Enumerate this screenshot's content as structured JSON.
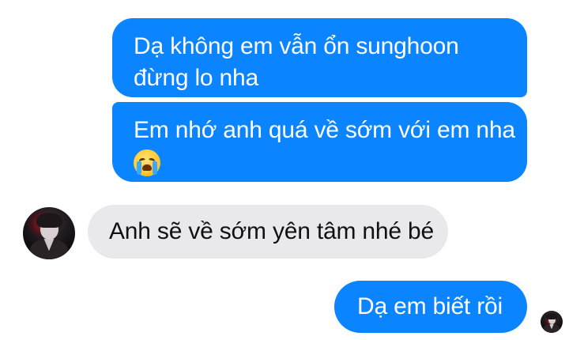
{
  "conversation": {
    "messages": [
      {
        "direction": "sent",
        "lines": [
          "Dạ không em vẫn ổn sunghoon",
          "đừng lo nha"
        ]
      },
      {
        "direction": "sent",
        "lines": [
          "Em nhớ anh quá về sớm với em nha"
        ],
        "emoji": "loudly-crying-face-icon"
      },
      {
        "direction": "received",
        "lines": [
          "Anh sẽ về sớm yên tâm nhé bé"
        ],
        "avatar": "contact-avatar"
      },
      {
        "direction": "sent",
        "lines": [
          "Dạ em biết rồi"
        ],
        "read_receipt": "seen-avatar"
      }
    ]
  },
  "colors": {
    "sent_bubble": "#0a84ff",
    "sent_text": "#ffffff",
    "received_bubble": "#e9e9eb",
    "received_text": "#111111",
    "background": "#ffffff"
  }
}
